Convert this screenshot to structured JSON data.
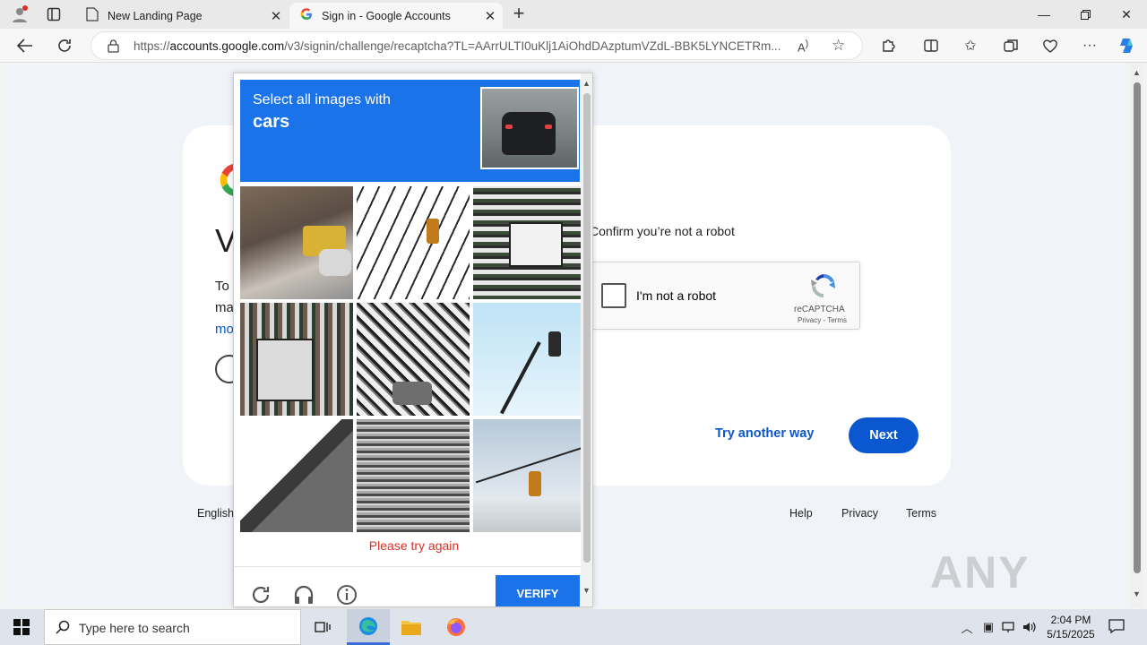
{
  "browser": {
    "tabs": [
      {
        "label": "New Landing Page",
        "active": false
      },
      {
        "label": "Sign in - Google Accounts",
        "active": true
      }
    ],
    "url_prefix": "https://",
    "url_host": "accounts.google.com",
    "url_path": "/v3/signin/challenge/recaptcha?TL=AArrULTI0uKlj1AiOhdDAzptumVZdL-BBK5LYNCETRm..."
  },
  "signin": {
    "heading_initial": "V",
    "desc_line1": "To",
    "desc_line2": "ma",
    "desc_line3": "mo",
    "confirm_label": "Confirm you’re not a robot",
    "try_another": "Try another way",
    "next": "Next"
  },
  "recaptcha": {
    "checkbox_label": "I'm not a robot",
    "brand": "reCAPTCHA",
    "privacy": "Privacy",
    "terms": "Terms",
    "separator": " - "
  },
  "challenge": {
    "prompt": "Select all images with",
    "target": "cars",
    "error": "Please try again",
    "verify": "VERIFY"
  },
  "footer": {
    "language": "English",
    "links": [
      "Help",
      "Privacy",
      "Terms"
    ]
  },
  "watermark": "ANY RUN",
  "taskbar": {
    "search_placeholder": "Type here to search",
    "time": "2:04 PM",
    "date": "5/15/2025"
  },
  "colors": {
    "google_blue": "#0b57d0",
    "captcha_blue": "#1a73e8",
    "error_red": "#d93025"
  }
}
